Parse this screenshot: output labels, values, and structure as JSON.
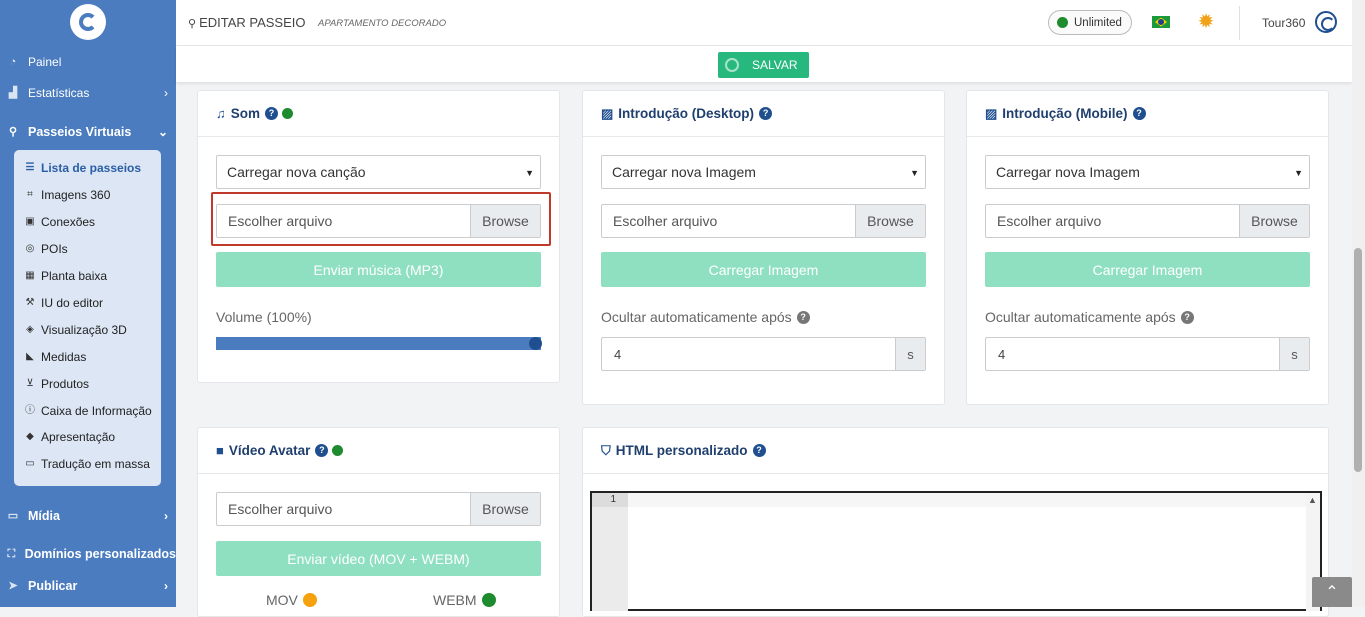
{
  "topbar": {
    "title": "EDITAR PASSEIO",
    "subtitle": "APARTAMENTO DECORADO",
    "plan_badge": "Unlimited",
    "username": "Tour360"
  },
  "toolbar": {
    "save_label": "SALVAR"
  },
  "sidebar": {
    "items": [
      {
        "label": "Painel",
        "icon": "gauge-icon"
      },
      {
        "label": "Estatísticas",
        "icon": "chart-icon"
      },
      {
        "label": "Passeios Virtuais",
        "icon": "route-icon"
      },
      {
        "label": "Mídia",
        "icon": "monitor-icon"
      },
      {
        "label": "Domínios personalizados",
        "icon": "sitemap-icon"
      },
      {
        "label": "Publicar",
        "icon": "send-icon"
      }
    ],
    "submenu": [
      {
        "label": "Lista de passeios",
        "icon": "list-icon"
      },
      {
        "label": "Imagens 360",
        "icon": "vector-square-icon"
      },
      {
        "label": "Conexões",
        "icon": "caret-square-icon"
      },
      {
        "label": "POIs",
        "icon": "bullseye-icon"
      },
      {
        "label": "Planta baixa",
        "icon": "map-icon"
      },
      {
        "label": "IU do editor",
        "icon": "tools-icon"
      },
      {
        "label": "Visualização 3D",
        "icon": "cube-icon"
      },
      {
        "label": "Medidas",
        "icon": "ruler-icon"
      },
      {
        "label": "Produtos",
        "icon": "cart-icon"
      },
      {
        "label": "Caixa de Informação",
        "icon": "info-icon"
      },
      {
        "label": "Apresentação",
        "icon": "diamond-icon"
      },
      {
        "label": "Tradução em massa",
        "icon": "language-icon"
      }
    ]
  },
  "som": {
    "title": "Som",
    "select_value": "Carregar nova canção",
    "file_placeholder": "Escolher arquivo",
    "browse": "Browse",
    "upload_button": "Enviar música (MP3)",
    "volume_label": "Volume (100%)",
    "volume_value": 100
  },
  "intro_desktop": {
    "title": "Introdução (Desktop)",
    "select_value": "Carregar nova Imagem",
    "file_placeholder": "Escolher arquivo",
    "browse": "Browse",
    "upload_button": "Carregar Imagem",
    "hide_label": "Ocultar automaticamente após",
    "hide_value": "4",
    "hide_unit": "s"
  },
  "intro_mobile": {
    "title": "Introdução (Mobile)",
    "select_value": "Carregar nova Imagem",
    "file_placeholder": "Escolher arquivo",
    "browse": "Browse",
    "upload_button": "Carregar Imagem",
    "hide_label": "Ocultar automaticamente após",
    "hide_value": "4",
    "hide_unit": "s"
  },
  "video_avatar": {
    "title": "Vídeo Avatar",
    "file_placeholder": "Escolher arquivo",
    "browse": "Browse",
    "upload_button": "Enviar vídeo (MOV + WEBM)",
    "mov_label": "MOV",
    "webm_label": "WEBM"
  },
  "custom_html": {
    "title": "HTML personalizado",
    "line_number": "1"
  },
  "colors": {
    "sidebar": "#4a7cbf",
    "accent_green": "#27b87e",
    "button_green_disabled": "#8fe0c0",
    "status_green": "#1e8b2e",
    "status_orange": "#f5a20c",
    "heading_blue": "#1f3f6e"
  }
}
